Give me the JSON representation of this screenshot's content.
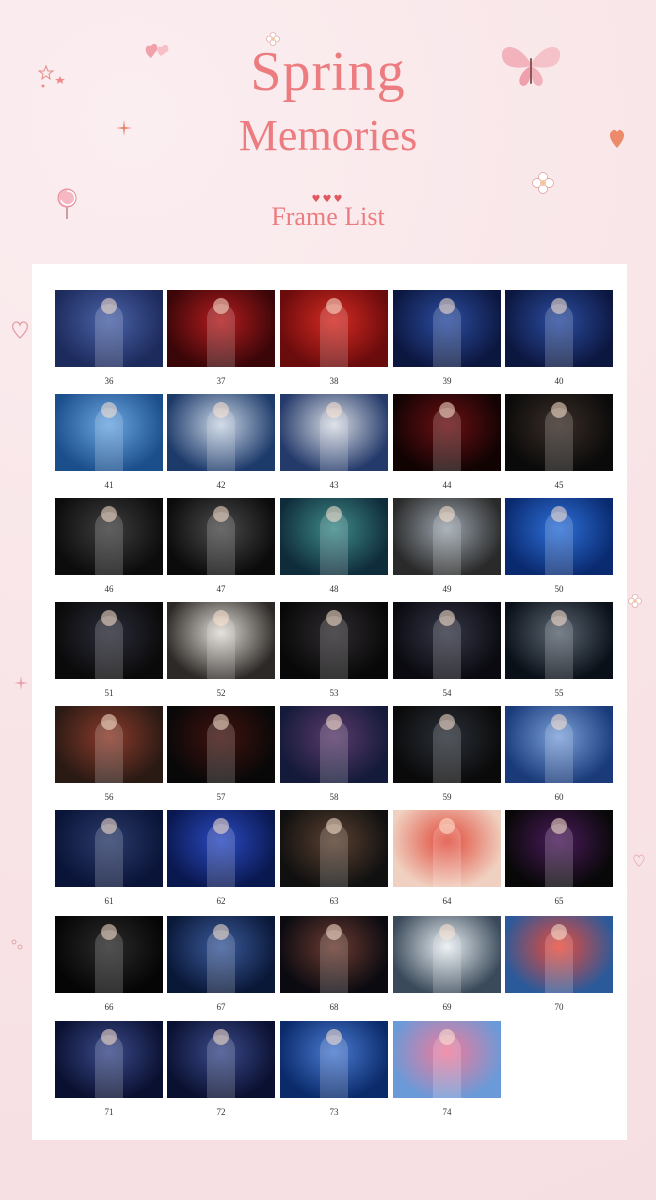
{
  "header": {
    "title_line1": "Spring",
    "title_line2": "Memories",
    "hearts": "♥♥♥",
    "subtitle": "Frame List"
  },
  "colors": {
    "background": "#f9e6e8",
    "title": "#ec7c80",
    "panel": "#ffffff"
  },
  "decorations": [
    "heart-balloon-icon",
    "flower-icon",
    "butterfly-icon",
    "star-icon",
    "heart-outline-icon",
    "lollipop-icon",
    "sparkle-icon"
  ],
  "frames": [
    {
      "label": "36",
      "tone": [
        "#1d2a5c",
        "#4a63a8"
      ]
    },
    {
      "label": "37",
      "tone": [
        "#3a0608",
        "#b31c1e"
      ]
    },
    {
      "label": "38",
      "tone": [
        "#6a0b0c",
        "#d42a22"
      ]
    },
    {
      "label": "39",
      "tone": [
        "#0c1740",
        "#2b4da0"
      ]
    },
    {
      "label": "40",
      "tone": [
        "#0c1740",
        "#2b4da0"
      ]
    },
    {
      "label": "41",
      "tone": [
        "#1b4f8c",
        "#6aa6e0"
      ]
    },
    {
      "label": "42",
      "tone": [
        "#1c3a6a",
        "#c8d4e4"
      ]
    },
    {
      "label": "43",
      "tone": [
        "#243a6a",
        "#d8dce4"
      ]
    },
    {
      "label": "44",
      "tone": [
        "#120303",
        "#6a0f12"
      ]
    },
    {
      "label": "45",
      "tone": [
        "#0a0a0a",
        "#3a2d26"
      ]
    },
    {
      "label": "46",
      "tone": [
        "#0c0c0c",
        "#3d3d3d"
      ]
    },
    {
      "label": "47",
      "tone": [
        "#0b0b0b",
        "#4a4a4a"
      ]
    },
    {
      "label": "48",
      "tone": [
        "#0f2c3a",
        "#3e8a8a"
      ]
    },
    {
      "label": "49",
      "tone": [
        "#2a2a2a",
        "#9aa4ad"
      ]
    },
    {
      "label": "50",
      "tone": [
        "#0a2a70",
        "#2d70d8"
      ]
    },
    {
      "label": "51",
      "tone": [
        "#0a0a0a",
        "#2b2b3a"
      ]
    },
    {
      "label": "52",
      "tone": [
        "#2d2926",
        "#e0dcd6"
      ]
    },
    {
      "label": "53",
      "tone": [
        "#080808",
        "#2e2a2e"
      ]
    },
    {
      "label": "54",
      "tone": [
        "#0a0a10",
        "#343646"
      ]
    },
    {
      "label": "55",
      "tone": [
        "#0a1018",
        "#5a6470"
      ]
    },
    {
      "label": "56",
      "tone": [
        "#2a1a14",
        "#8a3a2a"
      ]
    },
    {
      "label": "57",
      "tone": [
        "#080808",
        "#40120e"
      ]
    },
    {
      "label": "58",
      "tone": [
        "#141a3a",
        "#5a3a6a"
      ]
    },
    {
      "label": "59",
      "tone": [
        "#0a0a0a",
        "#2a2f38"
      ]
    },
    {
      "label": "60",
      "tone": [
        "#1a3a7a",
        "#7aa0d8"
      ]
    },
    {
      "label": "61",
      "tone": [
        "#0a1438",
        "#2a3a6a"
      ]
    },
    {
      "label": "62",
      "tone": [
        "#0a1850",
        "#2a4ac0"
      ]
    },
    {
      "label": "63",
      "tone": [
        "#101010",
        "#5a4030"
      ]
    },
    {
      "label": "64",
      "tone": [
        "#f0d0c0",
        "#e04a3a"
      ]
    },
    {
      "label": "65",
      "tone": [
        "#080808",
        "#4a1a5a"
      ]
    },
    {
      "label": "66",
      "tone": [
        "#050505",
        "#2a2a2a"
      ]
    },
    {
      "label": "67",
      "tone": [
        "#0a1838",
        "#3a5a9a"
      ]
    },
    {
      "label": "68",
      "tone": [
        "#0a0a10",
        "#6a3a30"
      ]
    },
    {
      "label": "69",
      "tone": [
        "#3a4a5a",
        "#e8eef2"
      ]
    },
    {
      "label": "70",
      "tone": [
        "#2a5a9a",
        "#e84a3a"
      ]
    },
    {
      "label": "71",
      "tone": [
        "#0a1030",
        "#3a4a8a"
      ]
    },
    {
      "label": "72",
      "tone": [
        "#0a1030",
        "#3a4a8a"
      ]
    },
    {
      "label": "73",
      "tone": [
        "#0a2a6a",
        "#4a7ad0"
      ]
    },
    {
      "label": "74",
      "tone": [
        "#6a9ad8",
        "#f07a9a"
      ]
    }
  ]
}
